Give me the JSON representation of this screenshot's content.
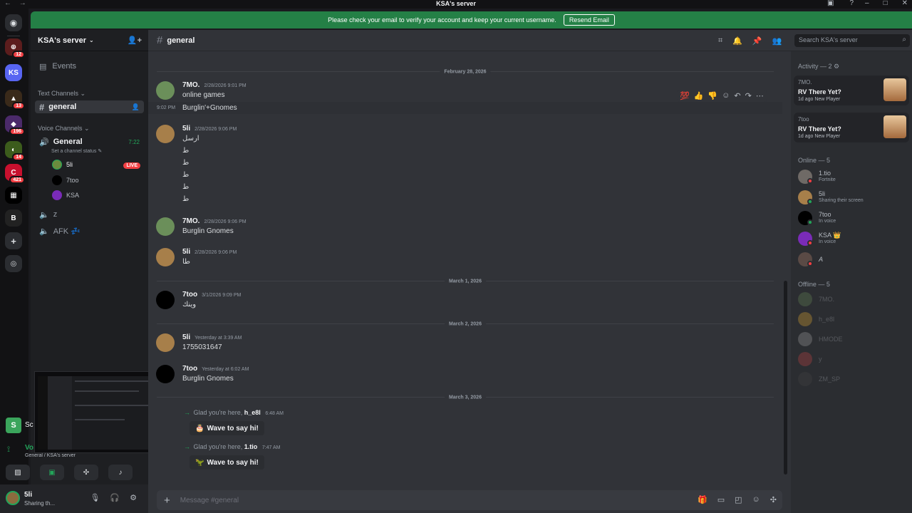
{
  "window": {
    "title": "KSA's server",
    "nav": "← →"
  },
  "banner": {
    "text": "Please check your email to verify your account and keep your current username.",
    "button": "Resend Email"
  },
  "guild_badges": [
    "12",
    "13",
    "196",
    "14",
    "421"
  ],
  "guild_initials": "KS",
  "server": {
    "name": "KSA's server"
  },
  "sidebar": {
    "events": "Events",
    "text_category": "Text Channels",
    "text_channel": "general",
    "voice_category": "Voice Channels",
    "voice_channel": "General",
    "voice_time": "7:22",
    "channel_status": "Set a channel status",
    "voice_users": [
      "5li",
      "7too",
      "KSA"
    ],
    "live_badge": "LIVE",
    "other_channels": [
      "z",
      "AFK 💤"
    ]
  },
  "voice_panel": {
    "stream_label": "Sc",
    "connection": "Vo",
    "location": "General / KSA's server"
  },
  "user_panel": {
    "name": "5li",
    "status": "Sharing th..."
  },
  "channel": {
    "name": "general",
    "search_placeholder": "Search KSA's server",
    "composer_placeholder": "Message #general"
  },
  "dates": [
    "February 28, 2026",
    "March 1, 2026",
    "March 2, 2026",
    "March 3, 2026"
  ],
  "messages": [
    {
      "author": "7MO.",
      "time": "2/28/2026 9:01 PM",
      "lines": [
        "online games"
      ]
    },
    {
      "sidetime": "9:02 PM",
      "lines": [
        "Burglin'+Gnomes"
      ]
    },
    {
      "author": "5li",
      "time": "2/28/2026 9:06 PM",
      "lines": [
        "ارسل",
        "ط",
        "ط",
        "ط",
        "ط",
        "ط"
      ]
    },
    {
      "author": "7MO.",
      "time": "2/28/2026 9:06 PM",
      "lines": [
        "Burglin Gnomes"
      ]
    },
    {
      "author": "5li",
      "time": "2/28/2026 9:06 PM",
      "lines": [
        "طا"
      ]
    },
    {
      "author": "7too",
      "time": "3/1/2026 9:09 PM",
      "lines": [
        "وينك"
      ]
    },
    {
      "author": "5li",
      "time": "Yesterday at 3:39 AM",
      "lines": [
        "1755031647"
      ]
    },
    {
      "author": "7too",
      "time": "Yesterday at 6:02 AM",
      "lines": [
        "Burglin Gnomes"
      ]
    }
  ],
  "system_messages": [
    {
      "prefix": "Glad you're here, ",
      "user": "h_e8l",
      "time": "6:48 AM",
      "wave": "Wave to say hi!"
    },
    {
      "prefix": "Glad you're here, ",
      "user": "1.tio",
      "time": "7:47 AM",
      "wave": "Wave to say hi!"
    }
  ],
  "members": {
    "activity_title": "Activity — 2",
    "activities": [
      {
        "who": "7MO.",
        "game": "RV There Yet?",
        "meta": "1d ago   New Player"
      },
      {
        "who": "7too",
        "game": "RV There Yet?",
        "meta": "1d ago   New Player"
      }
    ],
    "online_title": "Online — 5",
    "online": [
      {
        "name": "1.tio",
        "status": "Fortnite"
      },
      {
        "name": "5li",
        "status": "Sharing their screen"
      },
      {
        "name": "7too",
        "status": "In voice"
      },
      {
        "name": "KSA 👑",
        "status": "In voice"
      },
      {
        "name": "A",
        "status": ""
      }
    ],
    "offline_title": "Offline — 5",
    "offline": [
      "7MO.",
      "h_e8l",
      "HMODE",
      "y",
      "ZM_SP"
    ]
  },
  "colors": {
    "accent": "#248046",
    "live": "#f23f43",
    "online": "#23a55a",
    "dnd": "#f23f43"
  }
}
